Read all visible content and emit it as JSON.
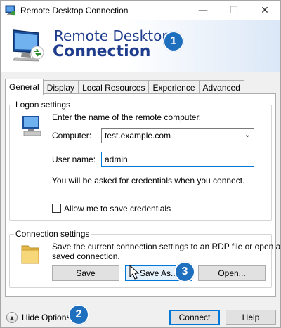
{
  "window": {
    "title": "Remote Desktop Connection",
    "minimize": "—",
    "maximize": "☐",
    "close": "✕"
  },
  "banner": {
    "line1": "Remote Desktop",
    "line2": "Connection"
  },
  "callouts": [
    "1",
    "2",
    "3"
  ],
  "tabs": [
    "General",
    "Display",
    "Local Resources",
    "Experience",
    "Advanced"
  ],
  "logon": {
    "legend": "Logon settings",
    "instruction": "Enter the name of the remote computer.",
    "computer_label": "Computer:",
    "computer_value": "test.example.com",
    "username_label": "User name:",
    "username_value": "admin",
    "credentials_note": "You will be asked for credentials when you connect.",
    "allow_save_label": "Allow me to save credentials",
    "allow_save_checked": false
  },
  "connection": {
    "legend": "Connection settings",
    "description_line1": "Save the current connection settings to an RDP file or open a",
    "description_line2": "saved connection.",
    "save": "Save",
    "save_as": "Save As...",
    "open": "Open..."
  },
  "footer": {
    "hide_options": "Hide Options",
    "connect": "Connect",
    "help": "Help"
  },
  "colors": {
    "accent": "#0078d7",
    "banner_text": "#1f3d8c",
    "callout": "#1f6fbf"
  }
}
